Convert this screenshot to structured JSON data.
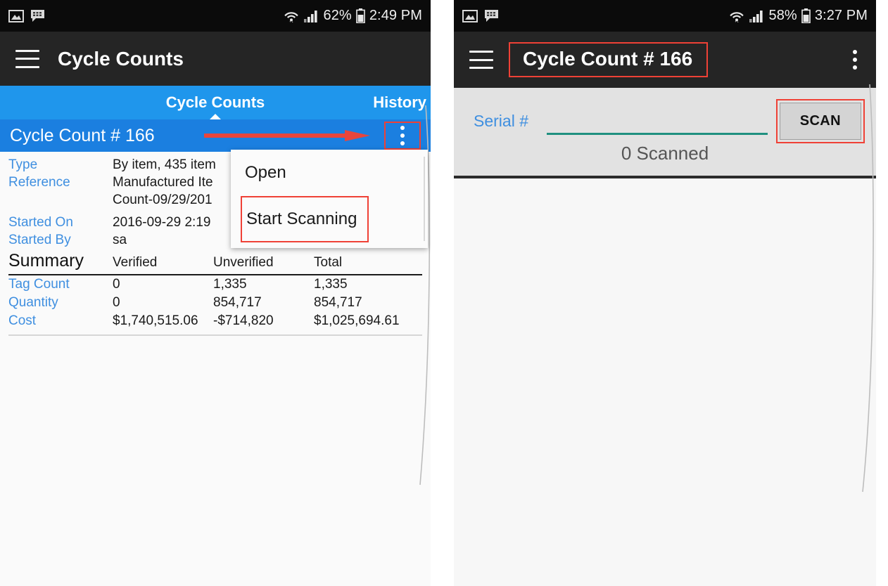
{
  "left_phone": {
    "status_bar": {
      "icons": [
        "image-icon",
        "message-icon"
      ],
      "wifi": "wifi-icon",
      "signal": "signal-icon",
      "battery_percent": "62%",
      "battery": "battery-icon",
      "time": "2:49 PM"
    },
    "app_bar": {
      "menu_icon": "hamburger-icon",
      "title": "Cycle Counts"
    },
    "tabs": [
      {
        "label": "Cycle Counts",
        "active": true
      },
      {
        "label": "History",
        "active": false
      }
    ],
    "record": {
      "title": "Cycle Count # 166",
      "overflow_icon": "kebab-menu-icon"
    },
    "details": [
      {
        "label": "Type",
        "value": "By item, 435 item"
      },
      {
        "label": "Reference",
        "value": "Manufactured Ite"
      },
      {
        "label": "",
        "value": "Count-09/29/201"
      },
      {
        "label": "Started On",
        "value": "2016-09-29 2:19"
      },
      {
        "label": "Started By",
        "value": "sa"
      }
    ],
    "summary": {
      "title": "Summary",
      "columns": [
        "Verified",
        "Unverified",
        "Total"
      ],
      "rows": [
        {
          "label": "Tag Count",
          "verified": "0",
          "unverified": "1,335",
          "total": "1,335"
        },
        {
          "label": "Quantity",
          "verified": "0",
          "unverified": "854,717",
          "total": "854,717"
        },
        {
          "label": "Cost",
          "verified": "$1,740,515.06",
          "unverified": "-$714,820",
          "total": "$1,025,694.61"
        }
      ]
    },
    "dropdown": {
      "items": [
        {
          "label": "Open",
          "highlighted": false
        },
        {
          "label": "Start Scanning",
          "highlighted": true
        }
      ]
    }
  },
  "right_phone": {
    "status_bar": {
      "icons": [
        "image-icon",
        "message-icon"
      ],
      "wifi": "wifi-icon",
      "signal": "signal-icon",
      "battery_percent": "58%",
      "battery": "battery-icon",
      "time": "3:27 PM"
    },
    "app_bar": {
      "menu_icon": "hamburger-icon",
      "title": "Cycle Count # 166",
      "overflow_icon": "kebab-menu-icon"
    },
    "scan": {
      "serial_label": "Serial #",
      "serial_value": "",
      "serial_placeholder": "",
      "scan_button": "SCAN",
      "scanned_text": "0 Scanned"
    }
  },
  "annotations": {
    "highlight_color": "#ef4136",
    "arrow_color": "#e8453c",
    "accent_blue": "#1f96ec",
    "row_blue": "#1b7fe0",
    "label_blue": "#3f8fe0",
    "input_underline": "#1f9080"
  }
}
